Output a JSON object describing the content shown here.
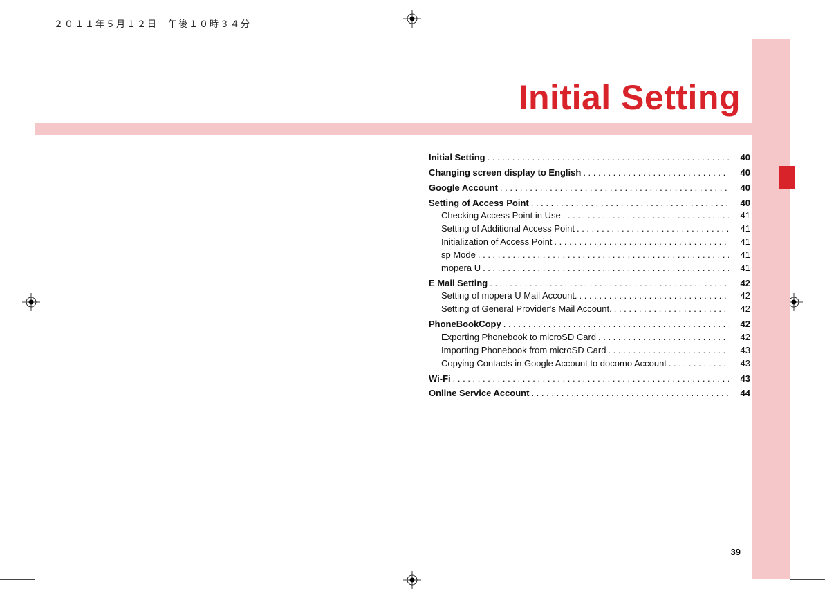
{
  "timestamp": "２０１１年５月１２日　午後１０時３４分",
  "headline": "Initial Setting",
  "page_number": "39",
  "colors": {
    "accent": "#d8232a",
    "tint": "#f6c7c9"
  },
  "toc": [
    {
      "level": "main",
      "label": "Initial Setting",
      "page": "40"
    },
    {
      "level": "main",
      "label": "Changing screen display to English",
      "page": "40"
    },
    {
      "level": "main",
      "label": "Google Account",
      "page": "40"
    },
    {
      "level": "main",
      "label": "Setting of Access Point",
      "page": "40"
    },
    {
      "level": "sub",
      "label": "Checking Access Point in Use",
      "page": "41"
    },
    {
      "level": "sub",
      "label": "Setting of Additional Access Point",
      "page": "41"
    },
    {
      "level": "sub",
      "label": "Initialization of Access Point",
      "page": "41"
    },
    {
      "level": "sub",
      "label": "sp Mode",
      "page": "41"
    },
    {
      "level": "sub",
      "label": "mopera U",
      "page": "41"
    },
    {
      "level": "main",
      "label": "E Mail Setting",
      "page": "42"
    },
    {
      "level": "sub",
      "label": "Setting of mopera U Mail Account.",
      "page": "42"
    },
    {
      "level": "sub",
      "label": "Setting of General Provider's Mail Account.",
      "page": "42"
    },
    {
      "level": "main",
      "label": "PhoneBookCopy",
      "page": "42"
    },
    {
      "level": "sub",
      "label": "Exporting Phonebook to microSD Card",
      "page": "42"
    },
    {
      "level": "sub",
      "label": "Importing Phonebook from microSD Card",
      "page": "43"
    },
    {
      "level": "sub",
      "label": "Copying Contacts in Google Account to docomo Account",
      "page": "43"
    },
    {
      "level": "main",
      "label": "Wi-Fi",
      "page": "43"
    },
    {
      "level": "main",
      "label": "Online Service Account",
      "page": "44"
    }
  ]
}
